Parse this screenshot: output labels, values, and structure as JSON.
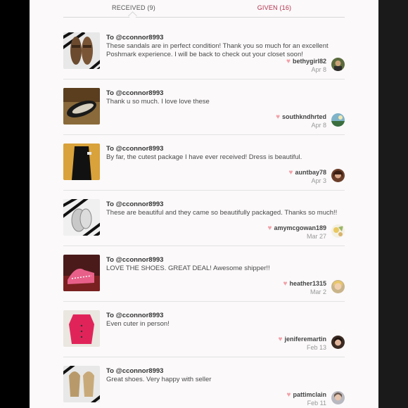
{
  "tabs": {
    "received": "RECEIVED (9)",
    "given": "GIVEN (16)"
  },
  "items": [
    {
      "to": "To @cconnor8993",
      "message": "These sandals are in perfect condition! Thank you so much for an excellent Poshmark experience. I will be back to check out your closet soon!",
      "user": "bethygirl82",
      "date": "Apr 8"
    },
    {
      "to": "To @cconnor8993",
      "message": "Thank u so much. I love love these",
      "user": "southkndhrted",
      "date": "Apr 8"
    },
    {
      "to": "To @cconnor8993",
      "message": "By far, the cutest package I have ever received! Dress is beautiful.",
      "user": "auntbay78",
      "date": "Apr 3"
    },
    {
      "to": "To @cconnor8993",
      "message": "These are beautiful and they came so beautifully packaged. Thanks so much!!",
      "user": "amymcgowan189",
      "date": "Mar 27"
    },
    {
      "to": "To @cconnor8993",
      "message": "LOVE THE SHOES. GREAT DEAL! Awesome shipper!!",
      "user": "heather1315",
      "date": "Mar 2"
    },
    {
      "to": "To @cconnor8993",
      "message": "Even cuter in person!",
      "user": "jeniferemartin",
      "date": "Feb 13"
    },
    {
      "to": "To @cconnor8993",
      "message": "Great shoes. Very happy with seller",
      "user": "pattimclain",
      "date": "Feb 11"
    }
  ],
  "colors": {
    "accent": "#b0304a",
    "heart": "#f2a0a8"
  },
  "icons": {
    "heart": "heart-icon"
  }
}
